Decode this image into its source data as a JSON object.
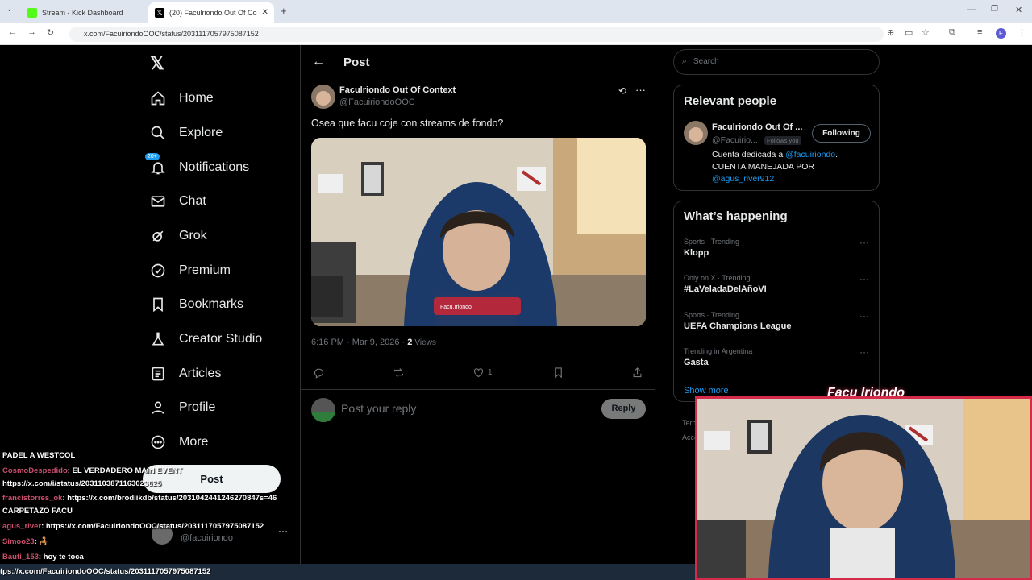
{
  "browser": {
    "tabs": [
      {
        "title": "Stream - Kick Dashboard"
      },
      {
        "title": "(20) Faculriondo Out Of Co"
      }
    ],
    "url": "x.com/FacuiriondoOOC/status/2031117057975087152"
  },
  "sidebar": {
    "items": [
      {
        "label": "Home",
        "icon": "home-icon"
      },
      {
        "label": "Explore",
        "icon": "search-icon"
      },
      {
        "label": "Notifications",
        "icon": "bell-icon",
        "badge": "20+"
      },
      {
        "label": "Chat",
        "icon": "mail-icon"
      },
      {
        "label": "Grok",
        "icon": "grok-icon"
      },
      {
        "label": "Premium",
        "icon": "verified-icon"
      },
      {
        "label": "Bookmarks",
        "icon": "bookmark-icon"
      },
      {
        "label": "Creator Studio",
        "icon": "flask-icon"
      },
      {
        "label": "Articles",
        "icon": "article-icon"
      },
      {
        "label": "Profile",
        "icon": "person-icon"
      },
      {
        "label": "More",
        "icon": "more-icon"
      }
    ],
    "post_label": "Post",
    "account_handle": "@facuiriondo"
  },
  "post": {
    "header": "Post",
    "author_name": "Faculriondo Out Of Context",
    "author_handle": "@FacuiriondoOOC",
    "text": "Osea que facu coje con streams de fondo?",
    "timestamp": "6:16 PM · Mar 9, 2026 ·",
    "views_count": "2",
    "views_label": "Views",
    "likes": "1",
    "reply_placeholder": "Post your reply",
    "reply_button": "Reply"
  },
  "right": {
    "search_placeholder": "Search",
    "relevant_title": "Relevant people",
    "person_name": "Faculriondo Out Of ...",
    "person_handle": "@Facuirio...",
    "follows_you": "Follows you",
    "following_label": "Following",
    "bio_1": "Cuenta dedicada a ",
    "bio_mention": "@facuiriondo",
    "bio_2": ". CUENTA MANEJADA POR",
    "bio_mention2": "@agus_river912",
    "happening_title": "What’s happening",
    "trends": [
      {
        "meta": "Sports · Trending",
        "name": "Klopp"
      },
      {
        "meta": "Only on X · Trending",
        "name": "#LaVeladaDelAñoVI"
      },
      {
        "meta": "Sports · Trending",
        "name": "UEFA Champions League"
      },
      {
        "meta": "Trending in Argentina",
        "name": "Gasta"
      }
    ],
    "show_more": "Show more",
    "terms": "Term",
    "access": "Acce"
  },
  "chat": [
    {
      "user": "",
      "text": "PADEL A WESTCOL"
    },
    {
      "user": "CosmoDespedido",
      "text": ": EL VERDADERO MAIN EVENT"
    },
    {
      "user": "",
      "text": "https://x.com/i/status/2031103871163023625"
    },
    {
      "user": "francistorres_ok",
      "text": ": https://x.com/brodiikdb/status/2031042441246270847s=46"
    },
    {
      "user": "",
      "text": "CARPETAZO FACU"
    },
    {
      "user": "agus_river",
      "text": ": https://x.com/FacuiriondoOOC/status/2031117057975087152"
    },
    {
      "user": "Simoo23",
      "text": ": 🦂"
    },
    {
      "user": "Bauti_153",
      "text": ": hoy te toca"
    }
  ],
  "status_url": "tps://x.com/FacuiriondoOOC/status/2031117057975087152",
  "webcam_title": "Facu Iriondo",
  "overlay_brand": "Facu.Iriondo",
  "colors": {
    "accent": "#1d9bf0",
    "webcam_border": "#d62a4a",
    "chat_user": "#c94f6d"
  }
}
